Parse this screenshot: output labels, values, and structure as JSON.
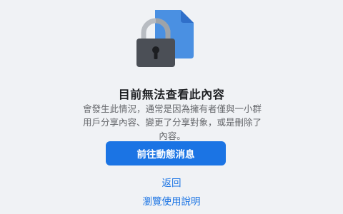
{
  "content_unavailable": {
    "icon": "locked-document-icon",
    "title": "目前無法查看此內容",
    "description": "會發生此情況，通常是因為擁有者僅與一小群用戶分享內容、變更了分享對象，或是刪除了內容。",
    "primary_button_label": "前往動態消息",
    "back_link_label": "返回",
    "help_link_label": "瀏覽使用說明"
  },
  "colors": {
    "background": "#f0f2f5",
    "primary": "#1b74e4",
    "document_blue": "#4a90e2",
    "lock_dark": "#4b4f56"
  }
}
